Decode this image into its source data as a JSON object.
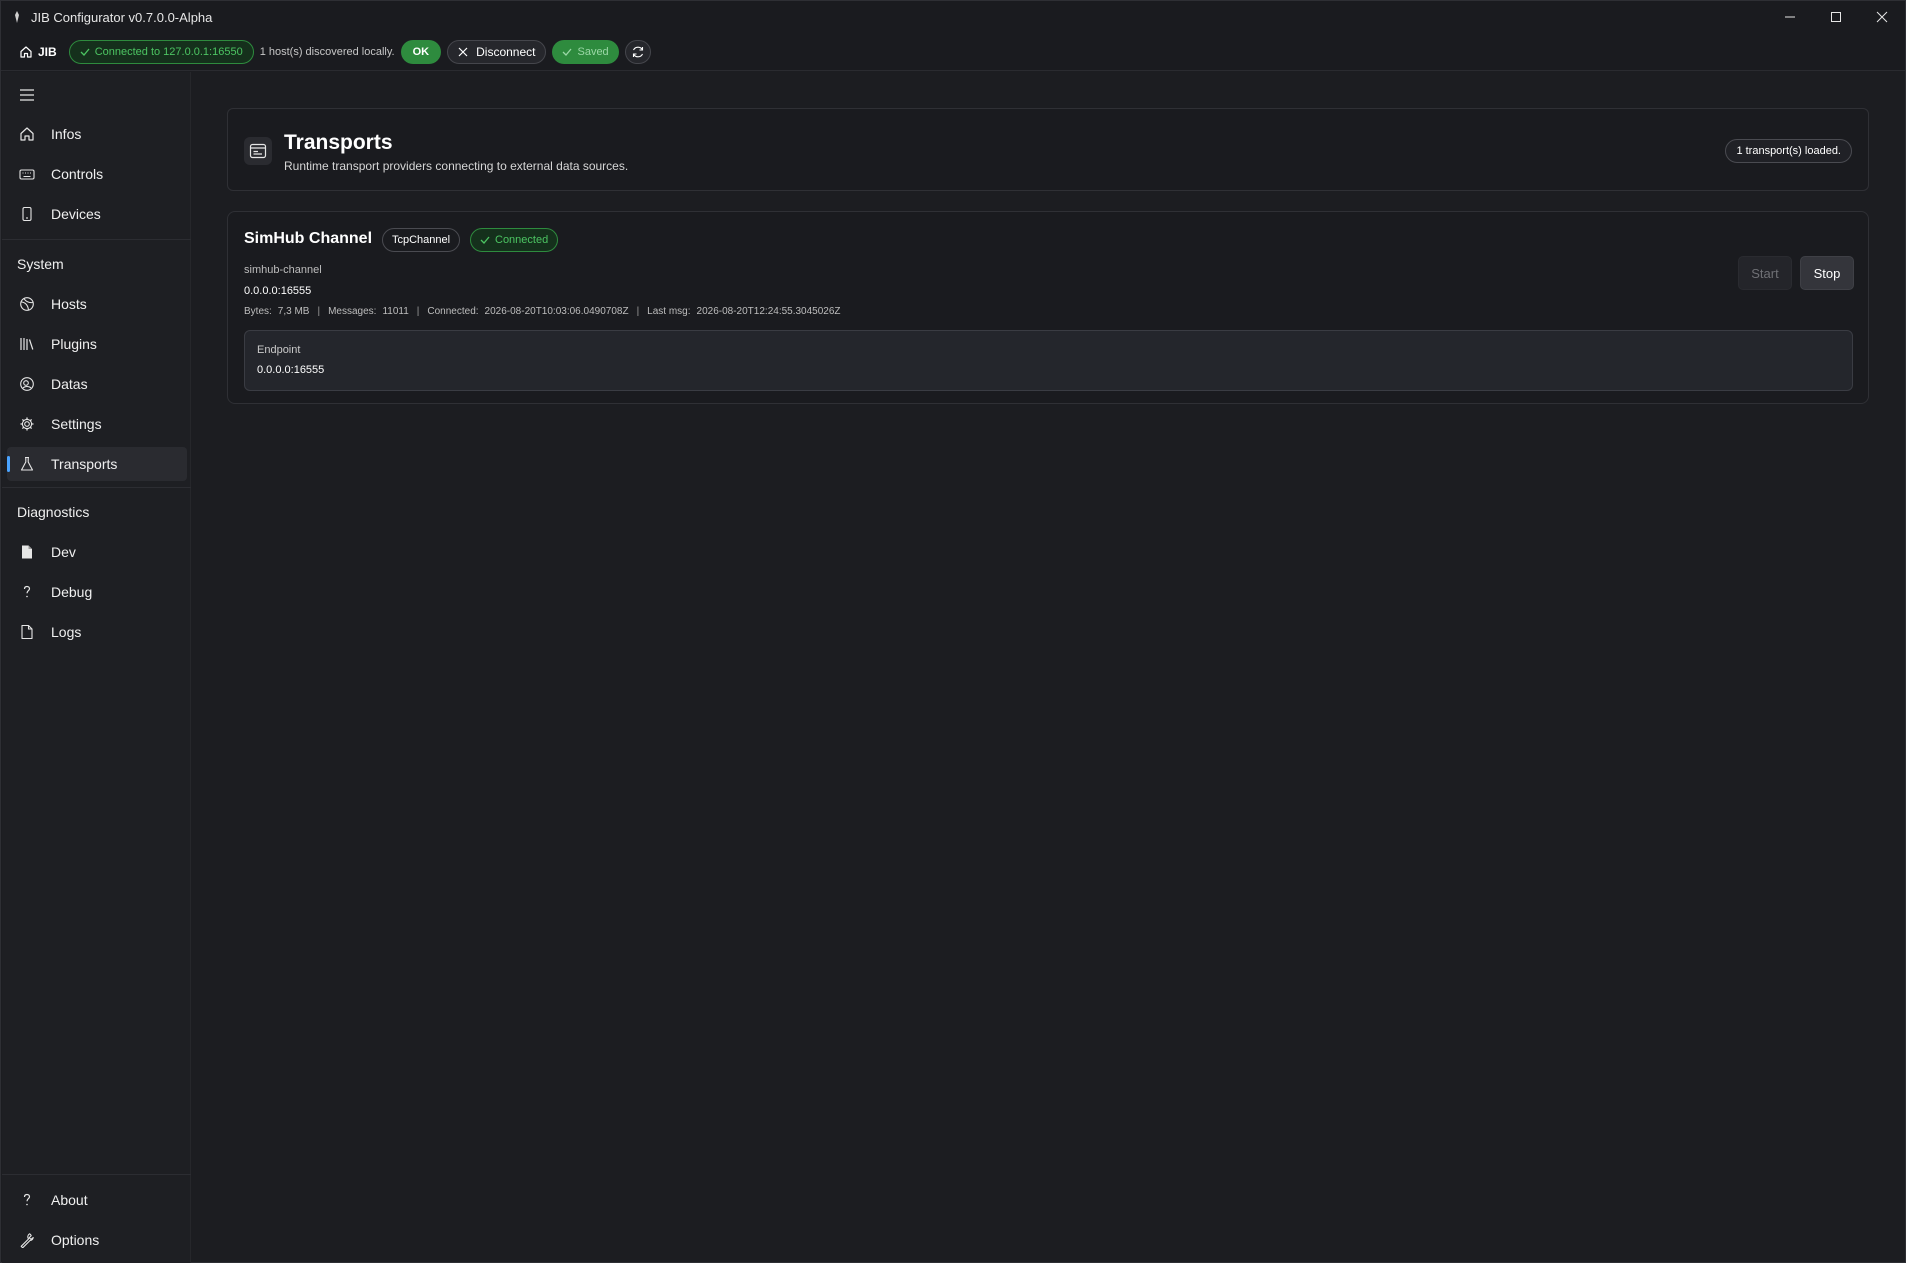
{
  "window": {
    "title": "JIB Configurator v0.7.0.0-Alpha"
  },
  "toolbar": {
    "brand": "JIB",
    "connection_status": "Connected to 127.0.0.1:16550",
    "discovery_hint": "1 host(s) discovered locally.",
    "ok_label": "OK",
    "disconnect_label": "Disconnect",
    "saved_label": "Saved",
    "colors": {
      "success": "#2e8b3e",
      "success_text": "#4cc462"
    }
  },
  "sidebar": {
    "top_items": [
      {
        "label": "Infos",
        "icon": "home-icon"
      },
      {
        "label": "Controls",
        "icon": "keyboard-icon"
      },
      {
        "label": "Devices",
        "icon": "phone-icon"
      }
    ],
    "system_header": "System",
    "system_items": [
      {
        "label": "Hosts",
        "icon": "globe-icon"
      },
      {
        "label": "Plugins",
        "icon": "library-icon"
      },
      {
        "label": "Datas",
        "icon": "data-icon"
      },
      {
        "label": "Settings",
        "icon": "gear-icon"
      },
      {
        "label": "Transports",
        "icon": "flask-icon",
        "active": true
      }
    ],
    "diagnostics_header": "Diagnostics",
    "diagnostics_items": [
      {
        "label": "Dev",
        "icon": "document-filled-icon"
      },
      {
        "label": "Debug",
        "icon": "question-icon"
      },
      {
        "label": "Logs",
        "icon": "document-icon"
      }
    ],
    "bottom_items": [
      {
        "label": "About",
        "icon": "question-icon"
      },
      {
        "label": "Options",
        "icon": "wrench-icon"
      }
    ],
    "accent": "#4aa3ff"
  },
  "page": {
    "title": "Transports",
    "subtitle": "Runtime transport providers connecting to external data sources.",
    "count_badge": "1 transport(s) loaded."
  },
  "transports": [
    {
      "name": "SimHub Channel",
      "type": "TcpChannel",
      "status": "Connected",
      "id": "simhub-channel",
      "address": "0.0.0.0:16555",
      "bytes_label": "Bytes:",
      "bytes": "7,3 MB",
      "messages_label": "Messages:",
      "messages": "11011",
      "connected_label": "Connected:",
      "connected_at": "2026-08-20T10:03:06.0490708Z",
      "last_msg_label": "Last msg:",
      "last_msg_at": "2026-08-20T12:24:55.3045026Z",
      "start_label": "Start",
      "stop_label": "Stop",
      "endpoint_label": "Endpoint",
      "endpoint_value": "0.0.0.0:16555"
    }
  ]
}
